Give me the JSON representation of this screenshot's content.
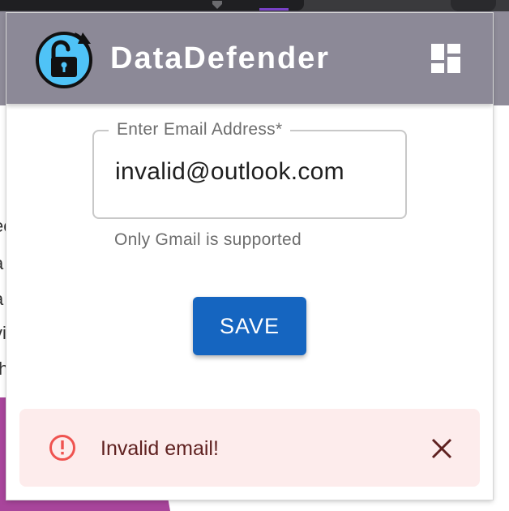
{
  "app": {
    "title": "DataDefender"
  },
  "form": {
    "email_label": "Enter Email Address",
    "required_marker": "*",
    "email_value": "invalid@outlook.com",
    "helper_text": "Only Gmail is supported",
    "save_label": "SAVE"
  },
  "alert": {
    "message": "Invalid email!",
    "severity": "error"
  },
  "background_page": {
    "fragments": [
      "ec",
      "a",
      "a",
      "vi",
      ".h"
    ]
  },
  "colors": {
    "app_bar": "#8c8997",
    "logo_fill": "#4fc3f7",
    "primary": "#1565c0",
    "alert_bg": "#fdecec",
    "alert_text": "#5f2120",
    "alert_icon": "#ef5350"
  },
  "icons": {
    "logo": "unlocked-padlock-refresh-icon",
    "dashboard": "dashboard-icon",
    "alert": "error-outline-icon",
    "close": "close-icon"
  }
}
